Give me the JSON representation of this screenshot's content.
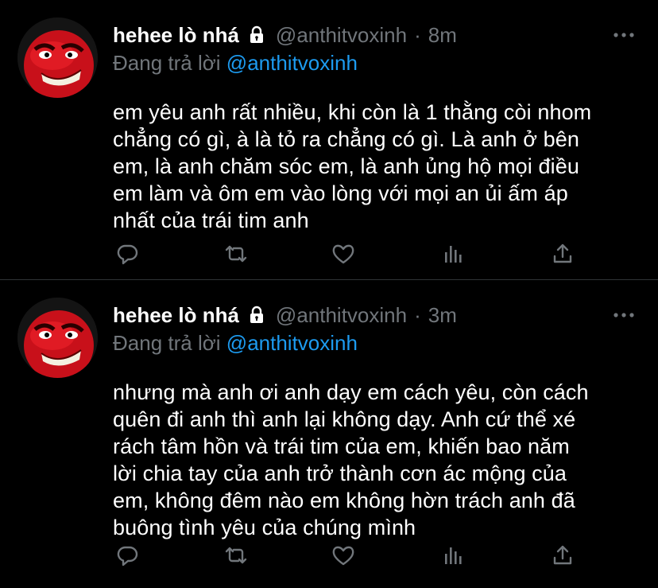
{
  "colors": {
    "background": "#000000",
    "text": "#ffffff",
    "muted": "#71767b",
    "link": "#1d9bf0",
    "divider": "#2f3336"
  },
  "tweets": [
    {
      "display_name": "hehee lò nhá",
      "handle": "@anthitvoxinh",
      "separator": "·",
      "time": "8m",
      "reply_prefix": "Đang trả lời",
      "reply_to": "@anthitvoxinh",
      "text": "em yêu anh rất nhiều, khi còn là 1 thằng còi nhom\nchẳng có gì, à là tỏ ra chẳng có gì. Là anh ở bên\nem, là anh chăm sóc em, là anh ủng hộ mọi điều\nem làm và ôm em vào lòng với mọi an ủi ấm áp\nnhất của trái tim anh",
      "icons": [
        "lock-icon",
        "more-icon",
        "reply-icon",
        "retweet-icon",
        "like-icon",
        "stats-icon",
        "share-icon"
      ]
    },
    {
      "display_name": "hehee lò nhá",
      "handle": "@anthitvoxinh",
      "separator": "·",
      "time": "3m",
      "reply_prefix": "Đang trả lời",
      "reply_to": "@anthitvoxinh",
      "text": "nhưng mà anh ơi anh dạy em cách yêu, còn cách\nquên đi anh thì anh lại không dạy. Anh cứ thể xé\nrách tâm hồn và trái tim của em, khiến bao năm\nlời chia tay của anh trở thành cơn ác mộng của\nem, không đêm nào em không hờn trách anh đã\nbuông tình yêu của chúng mình",
      "icons": [
        "lock-icon",
        "more-icon",
        "reply-icon",
        "retweet-icon",
        "like-icon",
        "stats-icon",
        "share-icon"
      ]
    }
  ]
}
